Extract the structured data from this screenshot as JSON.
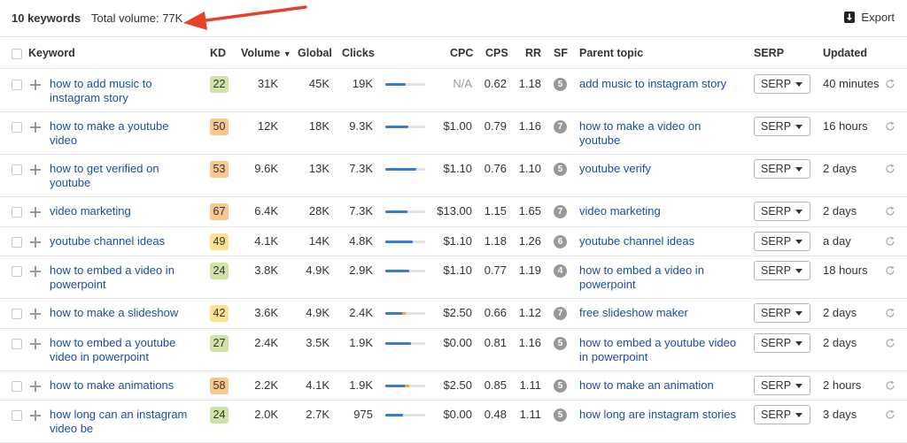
{
  "header": {
    "keywords_count": "10 keywords",
    "total_volume": "Total volume: 77K",
    "export_label": "Export",
    "annotation_arrow_color": "#e8402a"
  },
  "columns": {
    "keyword": "Keyword",
    "kd": "KD",
    "volume": "Volume",
    "global": "Global",
    "clicks": "Clicks",
    "cpc": "CPC",
    "cps": "CPS",
    "rr": "RR",
    "sf": "SF",
    "parent": "Parent topic",
    "serp": "SERP",
    "updated": "Updated"
  },
  "kd_colors": {
    "low": "#cfe3a8",
    "mid": "#fbe190",
    "high": "#f7c78c"
  },
  "rows": [
    {
      "keyword": "how to add music to instagram story",
      "kd": "22",
      "kd_level": "low",
      "volume": "31K",
      "global": "45K",
      "clicks": "19K",
      "click_share": 0.5,
      "paid_share": 0,
      "cpc": "N/A",
      "cpc_muted": true,
      "cps": "0.62",
      "rr": "1.18",
      "sf": "5",
      "parent": "add music to instagram story",
      "serp": "SERP",
      "updated": "40 minutes"
    },
    {
      "keyword": "how to make a youtube video",
      "kd": "50",
      "kd_level": "high",
      "volume": "12K",
      "global": "18K",
      "clicks": "9.3K",
      "click_share": 0.58,
      "paid_share": 0,
      "cpc": "$1.00",
      "cps": "0.79",
      "rr": "1.16",
      "sf": "7",
      "parent": "how to make a video on youtube",
      "serp": "SERP",
      "updated": "16 hours"
    },
    {
      "keyword": "how to get verified on youtube",
      "kd": "53",
      "kd_level": "high",
      "volume": "9.6K",
      "global": "13K",
      "clicks": "7.3K",
      "click_share": 0.78,
      "paid_share": 0,
      "cpc": "$1.10",
      "cps": "0.76",
      "rr": "1.10",
      "sf": "5",
      "parent": "youtube verify",
      "serp": "SERP",
      "updated": "2 days"
    },
    {
      "keyword": "video marketing",
      "kd": "67",
      "kd_level": "high",
      "volume": "6.4K",
      "global": "28K",
      "clicks": "7.3K",
      "click_share": 0.55,
      "paid_share": 0,
      "cpc": "$13.00",
      "cps": "1.15",
      "rr": "1.65",
      "sf": "7",
      "parent": "video marketing",
      "serp": "SERP",
      "updated": "2 days"
    },
    {
      "keyword": "youtube channel ideas",
      "kd": "49",
      "kd_level": "mid",
      "volume": "4.1K",
      "global": "14K",
      "clicks": "4.8K",
      "click_share": 0.7,
      "paid_share": 0,
      "cpc": "$1.10",
      "cps": "1.18",
      "rr": "1.26",
      "sf": "6",
      "parent": "youtube channel ideas",
      "serp": "SERP",
      "updated": "a day"
    },
    {
      "keyword": "how to embed a video in powerpoint",
      "kd": "24",
      "kd_level": "low",
      "volume": "3.8K",
      "global": "4.9K",
      "clicks": "2.9K",
      "click_share": 0.6,
      "paid_share": 0,
      "cpc": "$1.10",
      "cps": "0.77",
      "rr": "1.19",
      "sf": "4",
      "parent": "how to embed a video in powerpoint",
      "serp": "SERP",
      "updated": "18 hours"
    },
    {
      "keyword": "how to make a slideshow",
      "kd": "42",
      "kd_level": "mid",
      "volume": "3.6K",
      "global": "4.9K",
      "clicks": "2.4K",
      "click_share": 0.52,
      "paid_share": 0.08,
      "cpc": "$2.50",
      "cps": "0.66",
      "rr": "1.12",
      "sf": "7",
      "parent": "free slideshow maker",
      "serp": "SERP",
      "updated": "2 days"
    },
    {
      "keyword": "how to embed a youtube video in powerpoint",
      "kd": "27",
      "kd_level": "low",
      "volume": "2.4K",
      "global": "3.5K",
      "clicks": "1.9K",
      "click_share": 0.65,
      "paid_share": 0,
      "cpc": "$0.00",
      "cps": "0.81",
      "rr": "1.16",
      "sf": "5",
      "parent": "how to embed a youtube video in powerpoint",
      "serp": "SERP",
      "updated": "2 days"
    },
    {
      "keyword": "how to make animations",
      "kd": "58",
      "kd_level": "high",
      "volume": "2.2K",
      "global": "4.1K",
      "clicks": "1.9K",
      "click_share": 0.6,
      "paid_share": 0.1,
      "cpc": "$2.50",
      "cps": "0.85",
      "rr": "1.11",
      "sf": "5",
      "parent": "how to make an animation",
      "serp": "SERP",
      "updated": "2 hours"
    },
    {
      "keyword": "how long can an instagram video be",
      "kd": "24",
      "kd_level": "low",
      "volume": "2.0K",
      "global": "2.7K",
      "clicks": "975",
      "click_share": 0.45,
      "paid_share": 0,
      "cpc": "$0.00",
      "cps": "0.48",
      "rr": "1.11",
      "sf": "5",
      "parent": "how long are instagram stories",
      "serp": "SERP",
      "updated": "3 days"
    }
  ]
}
